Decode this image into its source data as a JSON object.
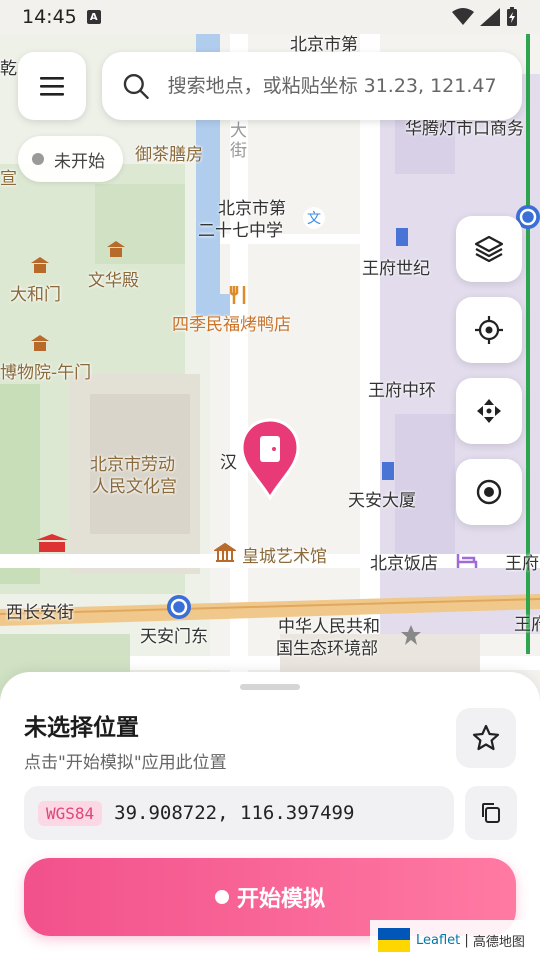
{
  "status_bar": {
    "time": "14:45",
    "notif_icon": "A"
  },
  "search": {
    "placeholder": "搜索地点，或粘贴坐标 31.23, 121.47"
  },
  "status_chip": {
    "label": "未开始"
  },
  "map_labels": {
    "l1": "北京市第",
    "l2": "乾",
    "l3": "华腾灯市口商务",
    "l4": "御茶膳房",
    "l5": "宣",
    "l6": "大",
    "l7": "街",
    "l8": "北京市第",
    "l9": "二十七中学",
    "l10": "王府世纪",
    "l11": "文华殿",
    "l12": "大和门",
    "l13": "四季民福烤鸭店",
    "l14": "博物院-午门",
    "l15": "王府中环",
    "l16": "王府",
    "l17": "北京市劳动",
    "l18": "人民文化宫",
    "l19": "汉",
    "l20": "天安大厦",
    "l21": "皇城艺术馆",
    "l22": "北京饭店",
    "l23": "王府",
    "l24": "西长安街",
    "l25": "天安门东",
    "l26": "中华人民共和",
    "l27": "国生态环境部",
    "l28": "王府"
  },
  "sheet": {
    "title": "未选择位置",
    "subtitle": "点击\"开始模拟\"应用此位置",
    "coord_system": "WGS84",
    "coordinates": "39.908722, 116.397499",
    "start_label": "开始模拟"
  },
  "attribution": {
    "leaflet": "Leaflet",
    "separator": " | ",
    "provider": "高德地图"
  },
  "colors": {
    "accent": "#f2518b",
    "pin": "#e93a78"
  }
}
